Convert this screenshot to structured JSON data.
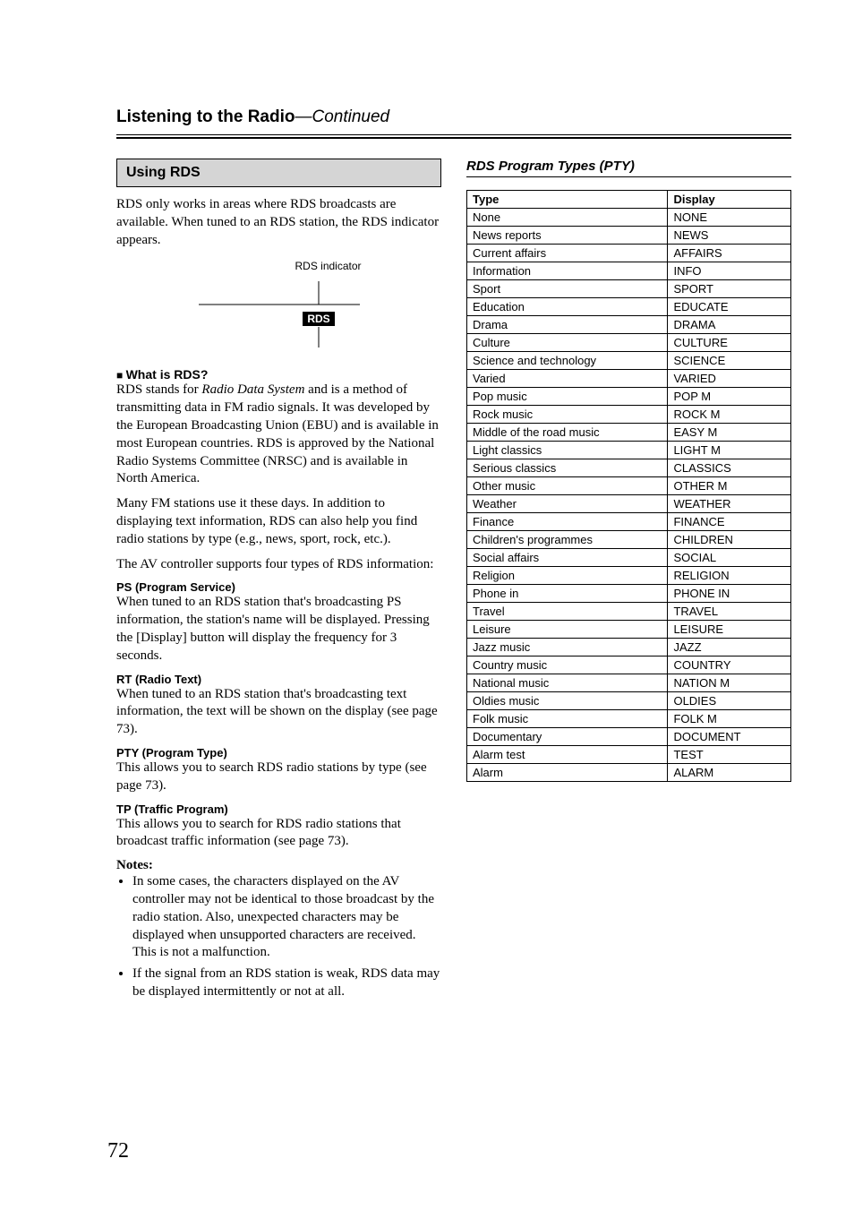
{
  "header": {
    "title_main": "Listening to the Radio",
    "title_cont": "—Continued"
  },
  "left": {
    "callout": "Using RDS",
    "intro": "RDS only works in areas where RDS broadcasts are available. When tuned to an RDS station, the RDS indicator appears.",
    "rds_indicator_label": "RDS indicator",
    "rds_badge": "RDS",
    "what_is_heading": "What is RDS?",
    "what_is_p1_a": "RDS stands for ",
    "what_is_p1_italic": "Radio Data System",
    "what_is_p1_b": " and is a method of transmitting data in FM radio signals. It was developed by the European Broadcasting Union (EBU) and is available in most European countries. RDS is approved by the National Radio Systems Committee (NRSC) and is available in North America.",
    "what_is_p2": "Many FM stations use it these days. In addition to displaying text information, RDS can also help you find radio stations by type (e.g., news, sport, rock, etc.).",
    "what_is_p3": "The AV controller supports four types of RDS information:",
    "ps_heading": "PS (Program Service)",
    "ps_body": "When tuned to an RDS station that's broadcasting PS information, the station's name will be displayed. Pressing the [Display] button will display the frequency for 3 seconds.",
    "rt_heading": "RT (Radio Text)",
    "rt_body": "When tuned to an RDS station that's broadcasting text information, the text will be shown on the display (see page 73).",
    "pty_heading": "PTY (Program Type)",
    "pty_body": "This allows you to search RDS radio stations by type (see page 73).",
    "tp_heading": "TP (Traffic Program)",
    "tp_body": "This allows you to search for RDS radio stations that broadcast traffic information (see page 73).",
    "notes_label": "Notes:",
    "notes": [
      "In some cases, the characters displayed on the AV controller may not be identical to those broadcast by the radio station. Also, unexpected characters may be displayed when unsupported characters are received. This is not a malfunction.",
      "If the signal from an RDS station is weak, RDS data may be displayed intermittently or not at all."
    ]
  },
  "right": {
    "title": "RDS Program Types (PTY)",
    "table": {
      "headers": [
        "Type",
        "Display"
      ],
      "rows": [
        [
          "None",
          "NONE"
        ],
        [
          "News reports",
          "NEWS"
        ],
        [
          "Current affairs",
          "AFFAIRS"
        ],
        [
          "Information",
          "INFO"
        ],
        [
          "Sport",
          "SPORT"
        ],
        [
          "Education",
          "EDUCATE"
        ],
        [
          "Drama",
          "DRAMA"
        ],
        [
          "Culture",
          "CULTURE"
        ],
        [
          "Science and technology",
          "SCIENCE"
        ],
        [
          "Varied",
          "VARIED"
        ],
        [
          "Pop music",
          "POP M"
        ],
        [
          "Rock music",
          "ROCK M"
        ],
        [
          "Middle of the road music",
          "EASY M"
        ],
        [
          "Light classics",
          "LIGHT M"
        ],
        [
          "Serious classics",
          "CLASSICS"
        ],
        [
          "Other music",
          "OTHER M"
        ],
        [
          "Weather",
          "WEATHER"
        ],
        [
          "Finance",
          "FINANCE"
        ],
        [
          "Children's programmes",
          "CHILDREN"
        ],
        [
          "Social affairs",
          "SOCIAL"
        ],
        [
          "Religion",
          "RELIGION"
        ],
        [
          "Phone in",
          "PHONE IN"
        ],
        [
          "Travel",
          "TRAVEL"
        ],
        [
          "Leisure",
          "LEISURE"
        ],
        [
          "Jazz music",
          "JAZZ"
        ],
        [
          "Country music",
          "COUNTRY"
        ],
        [
          "National music",
          "NATION M"
        ],
        [
          "Oldies music",
          "OLDIES"
        ],
        [
          "Folk music",
          "FOLK M"
        ],
        [
          "Documentary",
          "DOCUMENT"
        ],
        [
          "Alarm test",
          "TEST"
        ],
        [
          "Alarm",
          "ALARM"
        ]
      ]
    }
  },
  "page_number": "72"
}
